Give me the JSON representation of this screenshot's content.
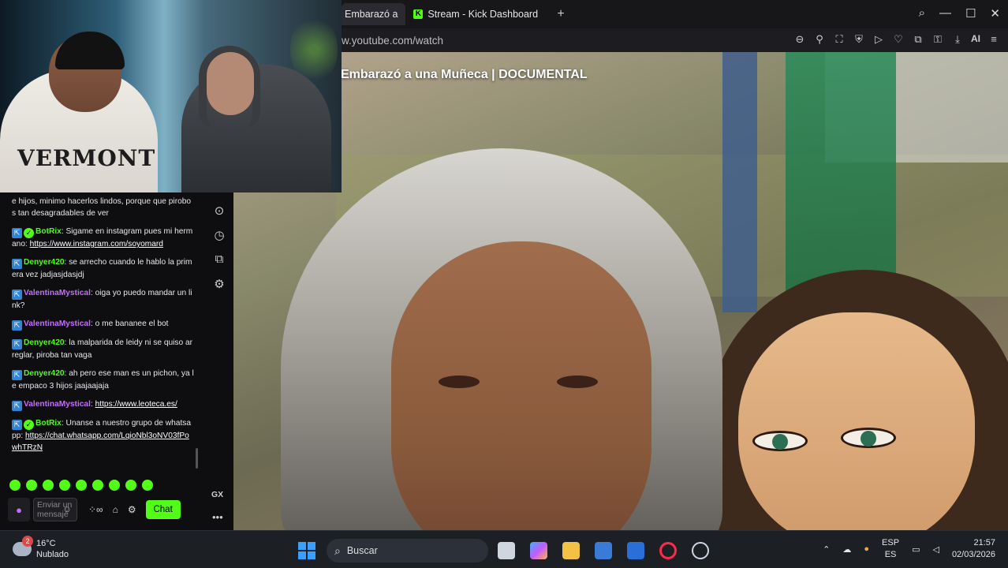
{
  "browser": {
    "tabs": [
      {
        "label": "Embarazó a",
        "active": true
      },
      {
        "label": "Stream - Kick Dashboard",
        "active": false
      }
    ],
    "new_tab_label": "+",
    "url": "w.youtube.com/watch",
    "ai_label": "AI"
  },
  "video": {
    "title": "Embarazó a una Muñeca | DOCUMENTAL"
  },
  "webcam": {
    "shirt_text": "VERMONT"
  },
  "chat": {
    "messages": [
      {
        "text": "e hijos, minimo hacerlos lindos, porque que pirobos tan desagradables de ver"
      },
      {
        "user": "BotRix",
        "user_color": "#53fc18",
        "text": ": Sigame en instagram pues mi hermano: ",
        "link": "https://www.instagram.com/soyomard"
      },
      {
        "user": "Denyer420",
        "user_color": "#53fc18",
        "text": ": se arrecho cuando le hablo la primera vez jadjasjdasjdj"
      },
      {
        "user": "ValentinaMystical",
        "user_color": "#c56bff",
        "text": ": oiga yo puedo mandar un link?"
      },
      {
        "user": "ValentinaMystical",
        "user_color": "#c56bff",
        "text": ": o me bananee el bot"
      },
      {
        "user": "Denyer420",
        "user_color": "#53fc18",
        "text": ": la malparida de leidy ni se quiso arreglar, piroba tan vaga"
      },
      {
        "user": "Denyer420",
        "user_color": "#53fc18",
        "text": ": ah pero ese man es un pichon, ya le empaco 3 hijos jaajaajaja"
      },
      {
        "user": "ValentinaMystical",
        "user_color": "#c56bff",
        "text": ": ",
        "link": "https://www.leoteca.es/"
      },
      {
        "user": "BotRix",
        "user_color": "#53fc18",
        "text": ": Unanse a nuestro grupo de whatsapp: ",
        "link": "https://chat.whatsapp.com/LqioNbl3oNV03fPowhTRzN"
      }
    ],
    "input_placeholder": "Enviar un mensaje",
    "send_label": "Chat",
    "accent": "#53fc18"
  },
  "sidebar": {
    "gx_label": "GX"
  },
  "taskbar": {
    "weather_badge": "2",
    "temperature": "16°C",
    "condition": "Nublado",
    "search_placeholder": "Buscar",
    "lang_top": "ESP",
    "lang_bottom": "ES",
    "time": "21:57",
    "date": "02/03/2026"
  }
}
